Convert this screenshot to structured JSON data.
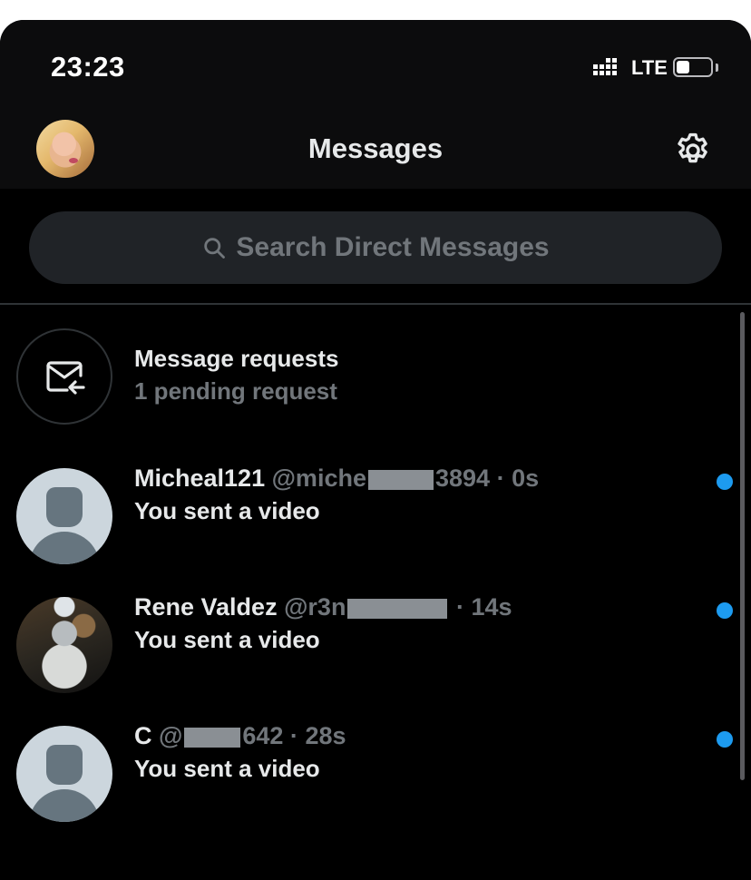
{
  "status_bar": {
    "time": "23:23",
    "network": "LTE",
    "battery_level": 0.4
  },
  "header": {
    "title": "Messages",
    "settings_icon": "gear-icon",
    "avatar_icon": "profile-avatar"
  },
  "search": {
    "placeholder": "Search Direct Messages",
    "icon": "search-icon"
  },
  "requests": {
    "title": "Message requests",
    "subtitle": "1 pending request",
    "icon": "mail-arrow-icon"
  },
  "conversations": [
    {
      "name": "Micheal121",
      "handle_prefix": "@miche",
      "handle_suffix": "3894",
      "separator": "·",
      "time": "0s",
      "preview": "You sent a video",
      "unread": true,
      "avatar": "default"
    },
    {
      "name": "Rene Valdez",
      "handle_prefix": "@r3n",
      "handle_suffix": "",
      "separator": "·",
      "time": "14s",
      "preview": "You sent a video",
      "unread": true,
      "avatar": "photo"
    },
    {
      "name": "C",
      "handle_prefix": "@",
      "handle_suffix": "642",
      "separator": "·",
      "time": "28s",
      "preview": "You sent a video",
      "unread": true,
      "avatar": "default"
    }
  ],
  "colors": {
    "accent": "#1d9bf0",
    "background": "#000000",
    "text": "#e7e9ea",
    "muted": "#71767b"
  }
}
